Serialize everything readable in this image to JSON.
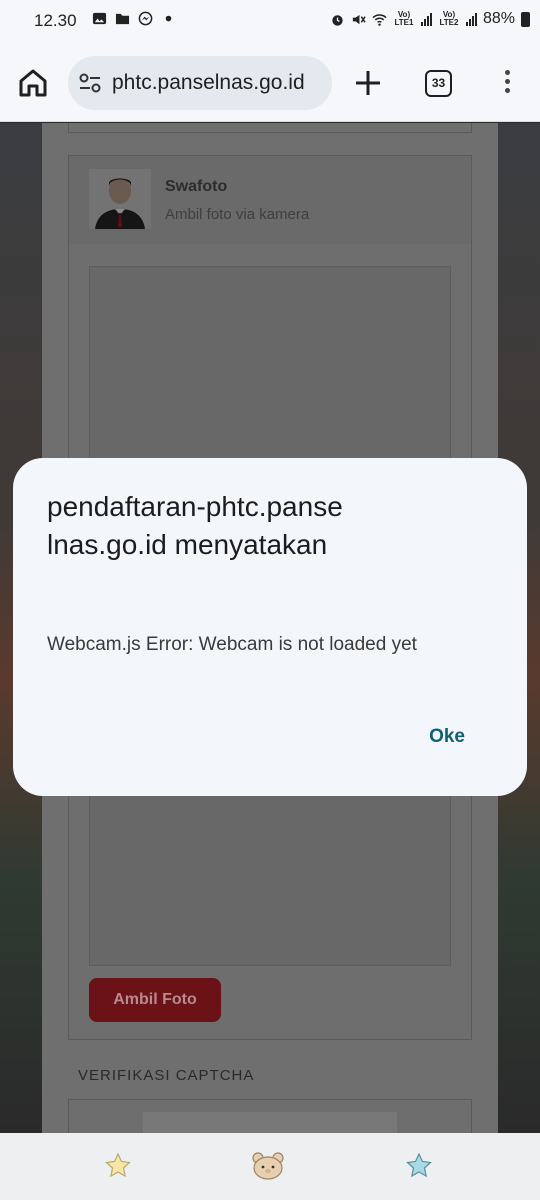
{
  "status_bar": {
    "time": "12.30",
    "lte1": "Vo) LTE1",
    "lte2": "Vo) LTE2",
    "battery": "88%"
  },
  "browser": {
    "url": "phtc.panselnas.go.id",
    "tab_count": "33"
  },
  "page": {
    "card_title": "Swafoto",
    "card_subtitle": "Ambil foto via kamera",
    "capture_button": "Ambil Foto",
    "captcha_heading": "VERIFIKASI CAPTCHA"
  },
  "dialog": {
    "title": "pendaftaran-phtc.panselnas.go.id menyatakan",
    "message": "Webcam.js Error: Webcam is not loaded yet",
    "ok_label": "Oke"
  },
  "colors": {
    "dialog_bg": "#f3f7fc",
    "ok_text": "#0f5f75",
    "capture_button_bg": "#6a1218"
  }
}
